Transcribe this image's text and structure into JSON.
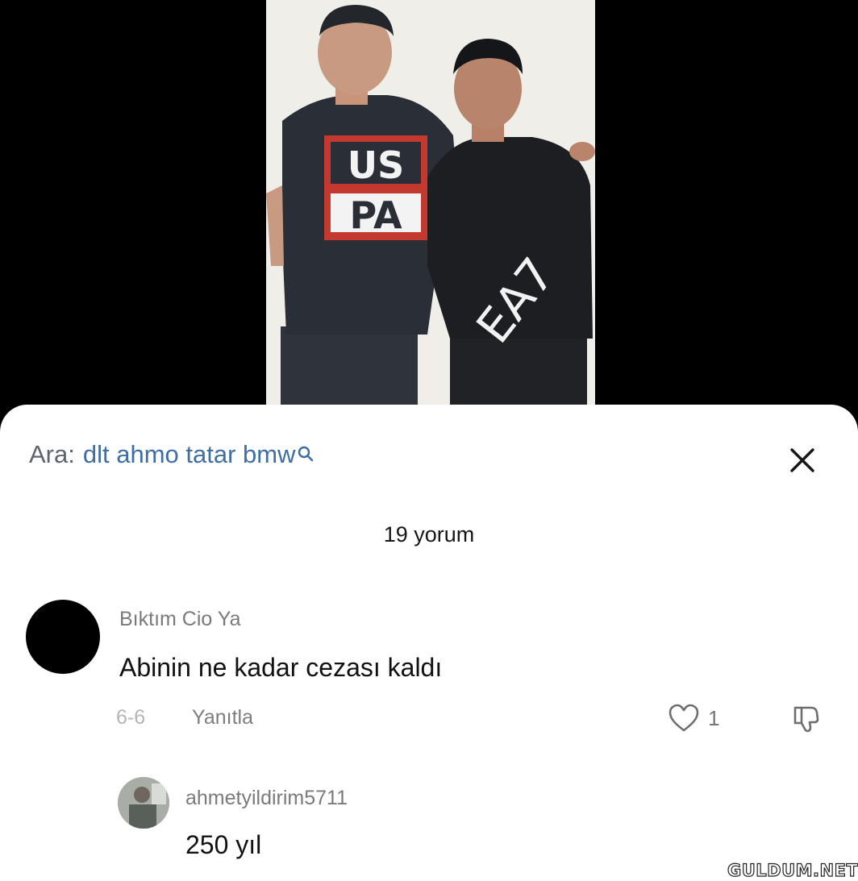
{
  "video": {
    "shirt_left_text_line1": "US",
    "shirt_left_text_line2": "PA",
    "shirt_right_text": "EA7"
  },
  "search": {
    "prefix": "Ara:",
    "query": "dlt ahmo tatar bmw"
  },
  "comments_count_label": "19 yorum",
  "comment": {
    "username": "Bıktım Cio Ya",
    "text": "Abinin ne kadar cezası kaldı",
    "date": "6-6",
    "reply_label": "Yanıtla",
    "likes": "1"
  },
  "reply": {
    "username": "ahmetyildirim5711",
    "text": "250 yıl"
  },
  "watermark": "GULDUM.NET",
  "colors": {
    "search_query": "#3f6ea5",
    "sheet_bg": "#ffffff",
    "video_bg": "#000000"
  }
}
